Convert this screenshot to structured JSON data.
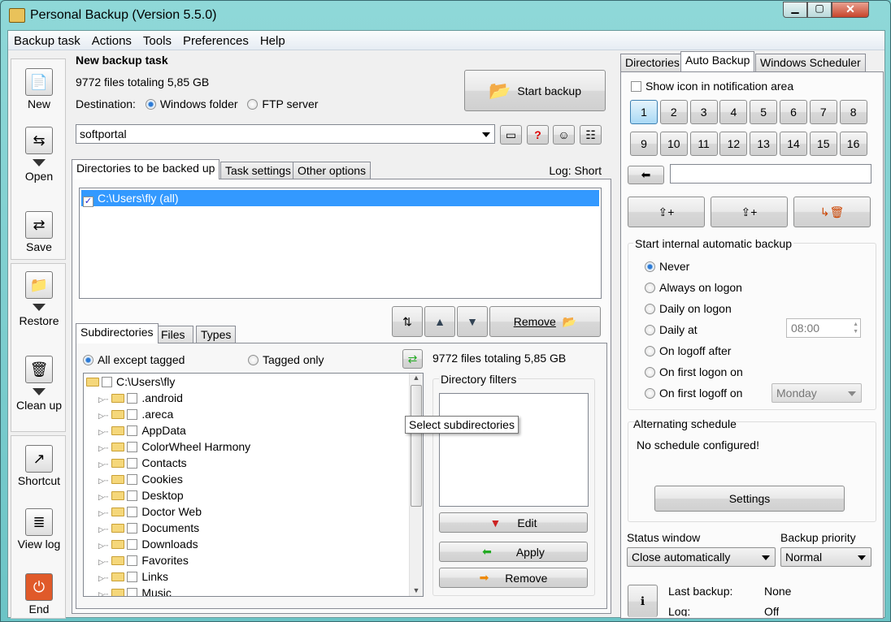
{
  "window": {
    "title": "Personal Backup (Version 5.5.0)"
  },
  "menu": [
    "Backup task",
    "Actions",
    "Tools",
    "Preferences",
    "Help"
  ],
  "toolbar": [
    {
      "label": "New",
      "icon": "new-task-icon"
    },
    {
      "label": "Open",
      "icon": "open-icon"
    },
    {
      "label": "Save",
      "icon": "save-icon"
    },
    {
      "label": "Restore",
      "icon": "restore-icon"
    },
    {
      "label": "Clean up",
      "icon": "trash-icon"
    },
    {
      "label": "Shortcut",
      "icon": "shortcut-icon"
    },
    {
      "label": "View log",
      "icon": "log-icon"
    },
    {
      "label": "End",
      "icon": "power-icon"
    }
  ],
  "task": {
    "title": "New backup task",
    "summary": "9772 files totaling 5,85 GB",
    "destination_label": "Destination:",
    "dest_options": [
      "Windows folder",
      "FTP server"
    ],
    "dest_selected": "Windows folder",
    "target": "softportal",
    "start_label": "Start backup"
  },
  "tabs": [
    "Directories to be backed up",
    "Task settings",
    "Other options"
  ],
  "log_label": "Log: Short",
  "directories": [
    {
      "path": "C:\\Users\\fly (all)",
      "checked": true
    }
  ],
  "subtabs": [
    "Subdirectories",
    "Files",
    "Types"
  ],
  "remove_label": "Remove",
  "sub": {
    "options": [
      "All except tagged",
      "Tagged only"
    ],
    "selected": "All except tagged",
    "summary": "9772 files totaling 5,85 GB",
    "root": "C:\\Users\\fly",
    "items": [
      ".android",
      ".areca",
      "AppData",
      "ColorWheel Harmony",
      "Contacts",
      "Cookies",
      "Desktop",
      "Doctor Web",
      "Documents",
      "Downloads",
      "Favorites",
      "Links",
      "Music"
    ],
    "tooltip": "Select subdirectories"
  },
  "filters": {
    "title": "Directory filters",
    "edit": "Edit",
    "apply": "Apply",
    "remove": "Remove"
  },
  "right": {
    "tabs": [
      "Directories",
      "Auto Backup",
      "Windows Scheduler"
    ],
    "show_icon": "Show icon in notification area",
    "numbers": [
      "1",
      "2",
      "3",
      "4",
      "5",
      "6",
      "7",
      "8",
      "9",
      "10",
      "11",
      "12",
      "13",
      "14",
      "15",
      "16"
    ],
    "selected_number": "1",
    "auto_title": "Start internal automatic backup",
    "auto_options": [
      "Never",
      "Always on logon",
      "Daily on logon",
      "Daily at",
      "On logoff after",
      "On first logon on",
      "On first logoff on"
    ],
    "auto_selected": "Never",
    "time": "08:00",
    "day": "Monday",
    "alt_title": "Alternating schedule",
    "alt_text": "No schedule configured!",
    "settings": "Settings",
    "status_label": "Status window",
    "status_value": "Close automatically",
    "priority_label": "Backup priority",
    "priority_value": "Normal",
    "last_backup_label": "Last backup:",
    "last_backup_value": "None",
    "log_label": "Log:",
    "log_value": "Off"
  }
}
